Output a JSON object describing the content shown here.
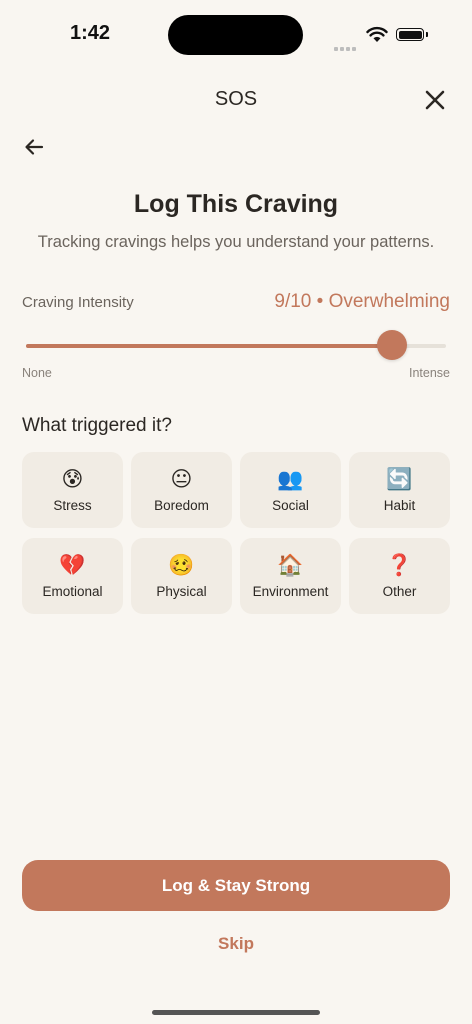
{
  "status_bar": {
    "time": "1:42"
  },
  "header": {
    "title": "SOS"
  },
  "page": {
    "title": "Log This Craving",
    "subtitle": "Tracking cravings helps you understand your patterns."
  },
  "intensity": {
    "label": "Craving Intensity",
    "value_text": "9/10 • Overwhelming",
    "value": 9,
    "max": 10,
    "min_label": "None",
    "max_label": "Intense"
  },
  "triggers": {
    "title": "What triggered it?",
    "items": [
      {
        "emoji": "😰",
        "label": "Stress"
      },
      {
        "emoji": "😐",
        "label": "Boredom"
      },
      {
        "emoji": "👥",
        "label": "Social"
      },
      {
        "emoji": "🔄",
        "label": "Habit"
      },
      {
        "emoji": "💔",
        "label": "Emotional"
      },
      {
        "emoji": "🥴",
        "label": "Physical"
      },
      {
        "emoji": "🏠",
        "label": "Environment"
      },
      {
        "emoji": "❓",
        "label": "Other"
      }
    ]
  },
  "actions": {
    "primary_label": "Log & Stay Strong",
    "skip_label": "Skip"
  },
  "colors": {
    "accent": "#c2785c",
    "background": "#f9f6f1",
    "card": "#f1ece4"
  }
}
